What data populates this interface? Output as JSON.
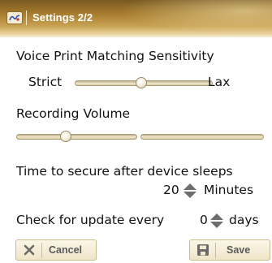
{
  "header": {
    "title": "Settings 2/2",
    "app_icon": "app-logo-icon"
  },
  "voice_print": {
    "label": "Voice Print Matching Sensitivity",
    "min_label": "Strict",
    "max_label": "Lax",
    "value_fraction": 0.48
  },
  "recording_volume": {
    "label": "Recording Volume",
    "value_fraction": 0.2
  },
  "secure_timeout": {
    "label": "Time to secure after device sleeps",
    "value": "20",
    "unit": "Minutes"
  },
  "update_check": {
    "label": "Check for update every",
    "value": "0",
    "unit": "days"
  },
  "buttons": {
    "cancel_label": "Cancel",
    "save_label": "Save"
  },
  "colors": {
    "header_dark": "#7a5a22",
    "header_light": "#f7efd8",
    "spinner": "#6e6e6e",
    "button_bg": "#f4ecd4"
  }
}
